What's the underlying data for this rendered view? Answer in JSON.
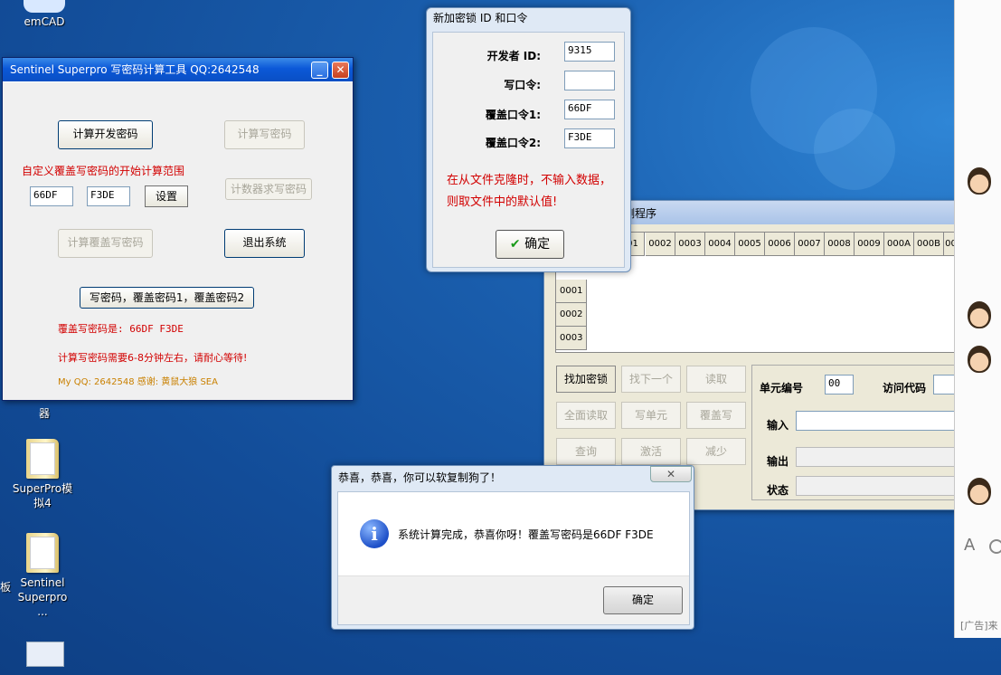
{
  "desktop": {
    "icons": [
      {
        "label": "emCAD"
      },
      {
        "label": "器"
      },
      {
        "label": "SuperPro模拟4"
      },
      {
        "label": "Sentinel Superpro ..."
      },
      {
        "label": "板"
      }
    ]
  },
  "calc_window": {
    "title": "Sentinel Superpro 写密码计算工具 QQ:2642548",
    "btn_calc_dev": "计算开发密码",
    "btn_calc_write": "计算写密码",
    "custom_range_label": "自定义覆盖写密码的开始计算范围",
    "field1": "66DF",
    "field2": "F3DE",
    "btn_set": "设置",
    "btn_counter_write": "计数器求写密码",
    "btn_calc_overwrite": "计算覆盖写密码",
    "btn_exit": "退出系统",
    "btn_write_all": "写密码，覆盖密码1，覆盖密码2",
    "overwrite_result": "覆盖写密码是:  66DF  F3DE",
    "wait_note": "计算写密码需要6-8分钟左右，请耐心等待!",
    "credits": "My QQ: 2642548  感谢:  黄鼠大狼  SEA"
  },
  "add_key_dialog": {
    "title": "新加密锁 ID 和口令",
    "dev_id_label": "开发者 ID:",
    "dev_id_value": "9315",
    "write_pw_label": "写口令:",
    "write_pw_value": "",
    "overwrite1_label": "覆盖口令1:",
    "overwrite1_value": "66DF",
    "overwrite2_label": "覆盖口令2:",
    "overwrite2_value": "F3DE",
    "note_line1": "在从文件克隆时，不输入数据，",
    "note_line2": "则取文件中的默认值!",
    "ok_label": "确定"
  },
  "detector_window": {
    "title": "测程序",
    "col_headers": [
      "01",
      "0002",
      "0003",
      "0004",
      "0005",
      "0006",
      "0007",
      "0008",
      "0009",
      "000A",
      "000B",
      "00"
    ],
    "row_headers": [
      "0001",
      "0002",
      "0003"
    ],
    "buttons": [
      {
        "label": "找加密锁",
        "enabled": true
      },
      {
        "label": "找下一个",
        "enabled": false
      },
      {
        "label": "读取",
        "enabled": false
      },
      {
        "label": "全面读取",
        "enabled": false
      },
      {
        "label": "写单元",
        "enabled": false
      },
      {
        "label": "覆盖写",
        "enabled": false
      },
      {
        "label": "查询",
        "enabled": false
      },
      {
        "label": "激活",
        "enabled": false
      },
      {
        "label": "减少",
        "enabled": false
      }
    ],
    "unit_label": "单元编号",
    "unit_value": "00",
    "access_label": "访问代码",
    "input_label": "输入",
    "output_label": "输出",
    "status_label": "状态"
  },
  "success_dialog": {
    "title": "恭喜，恭喜，你可以软复制狗了！",
    "message": "系统计算完成，恭喜你呀！覆盖写密码是66DF   F3DE",
    "ok_label": "确定"
  },
  "side_panel": {
    "font_icon_label": "A",
    "ad_text": "[广告]来"
  }
}
